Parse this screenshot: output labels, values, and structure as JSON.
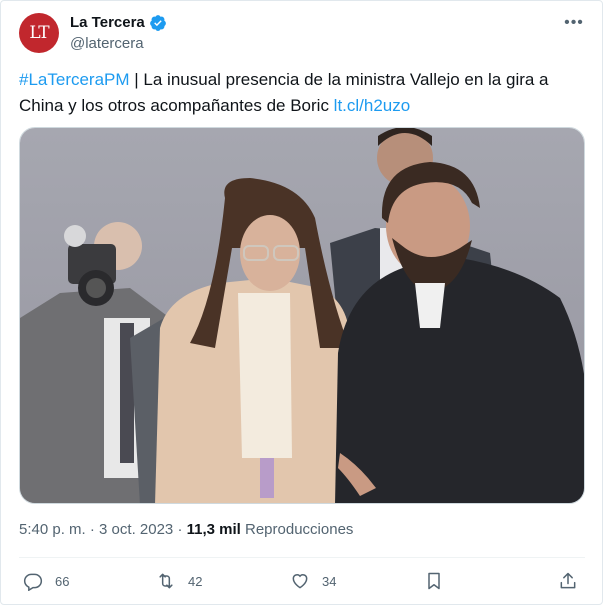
{
  "author": {
    "avatar_text": "LT",
    "name": "La Tercera",
    "handle": "@latercera",
    "verified": true
  },
  "tweet": {
    "hashtag": "#LaTerceraPM",
    "body": " | La inusual presencia de la ministra Vallejo en la gira a China y los otros acompañantes de Boric ",
    "link": "lt.cl/h2uzo"
  },
  "meta": {
    "time": "5:40 p. m.",
    "separator": " · ",
    "date": "3 oct. 2023",
    "separator2": " · ",
    "views_count": "11,3 mil",
    "views_label": " Reproducciones"
  },
  "actions": {
    "replies": "66",
    "retweets": "42",
    "likes": "34"
  },
  "colors": {
    "brand": "#c1272d",
    "link": "#1d9bf0",
    "muted": "#536471"
  }
}
